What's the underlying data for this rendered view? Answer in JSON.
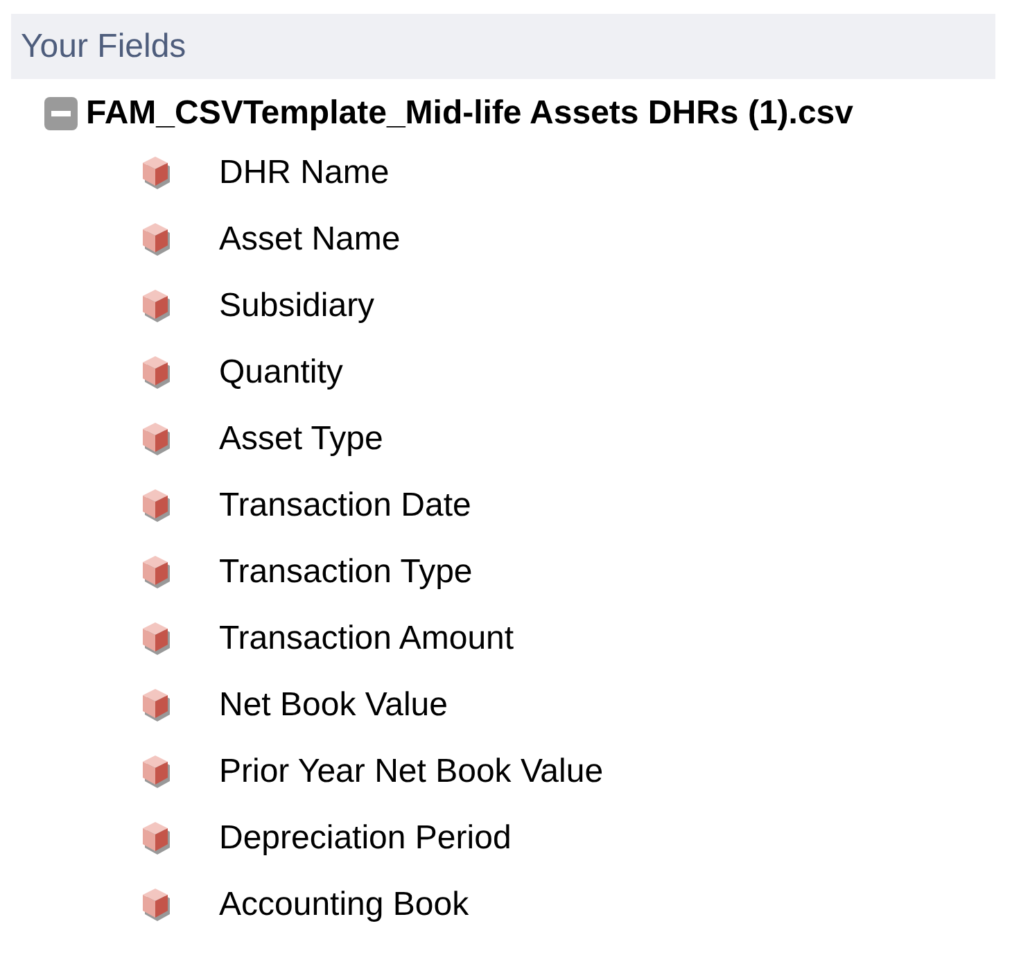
{
  "header": {
    "title": "Your Fields"
  },
  "tree": {
    "label": "FAM_CSVTemplate_Mid-life Assets DHRs (1).csv",
    "expanded": true,
    "children": [
      {
        "label": "DHR Name"
      },
      {
        "label": "Asset Name"
      },
      {
        "label": "Subsidiary"
      },
      {
        "label": "Quantity"
      },
      {
        "label": "Asset Type"
      },
      {
        "label": "Transaction Date"
      },
      {
        "label": "Transaction Type"
      },
      {
        "label": "Transaction Amount"
      },
      {
        "label": "Net Book Value"
      },
      {
        "label": "Prior Year Net Book Value"
      },
      {
        "label": "Depreciation Period"
      },
      {
        "label": "Accounting Book"
      }
    ]
  }
}
